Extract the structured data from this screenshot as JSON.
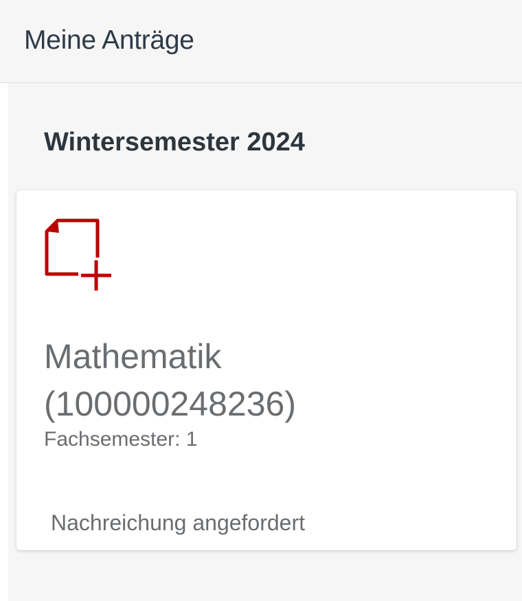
{
  "header": {
    "title": "Meine Anträge"
  },
  "section": {
    "title": "Wintersemester 2024"
  },
  "tile": {
    "icon": "document-add-icon",
    "icon_color": "#bb0000",
    "title_line1": "Mathematik",
    "title_line2": "(100000248236)",
    "subheader": "Fachsemester: 1",
    "footer": "Nachreichung angefordert"
  }
}
